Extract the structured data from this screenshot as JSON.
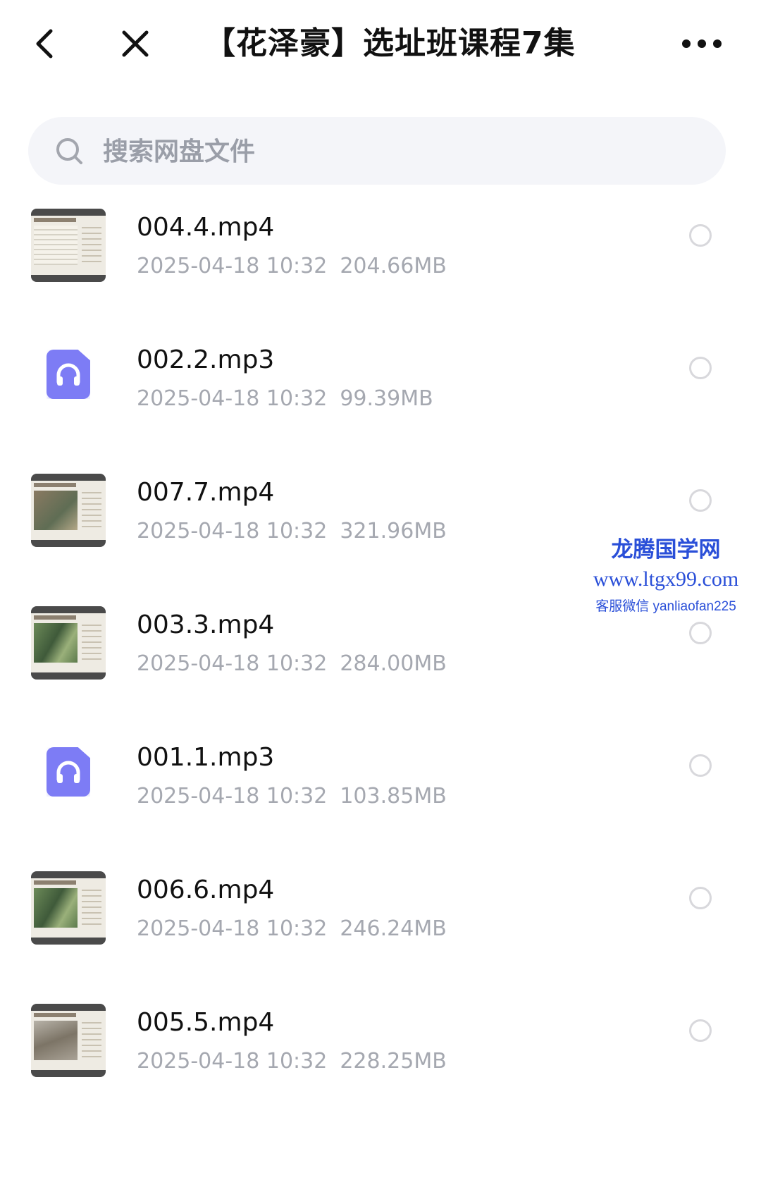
{
  "header": {
    "title": "【花泽豪】选址班课程7集",
    "back_icon": "chevron-left-icon",
    "close_icon": "close-icon",
    "more_icon": "more-horizontal-icon"
  },
  "search": {
    "placeholder": "搜索网盘文件",
    "icon": "search-icon"
  },
  "files": [
    {
      "name": "004.4.mp4",
      "date": "2025-04-18  10:32",
      "size": "204.66MB",
      "type": "video"
    },
    {
      "name": "002.2.mp3",
      "date": "2025-04-18  10:32",
      "size": "99.39MB",
      "type": "audio"
    },
    {
      "name": "007.7.mp4",
      "date": "2025-04-18  10:32",
      "size": "321.96MB",
      "type": "video"
    },
    {
      "name": "003.3.mp4",
      "date": "2025-04-18  10:32",
      "size": "284.00MB",
      "type": "video"
    },
    {
      "name": "001.1.mp3",
      "date": "2025-04-18  10:32",
      "size": "103.85MB",
      "type": "audio"
    },
    {
      "name": "006.6.mp4",
      "date": "2025-04-18  10:32",
      "size": "246.24MB",
      "type": "video"
    },
    {
      "name": "005.5.mp4",
      "date": "2025-04-18  10:32",
      "size": "228.25MB",
      "type": "video"
    }
  ],
  "watermark": {
    "title": "龙腾国学网",
    "url": "www.ltgx99.com",
    "contact": "客服微信 yanliaofan225"
  },
  "colors": {
    "accent_audio": "#7d7cf5",
    "meta_text": "#a5a8b0",
    "watermark": "#2a4fd8",
    "search_bg": "#f4f5f9"
  }
}
